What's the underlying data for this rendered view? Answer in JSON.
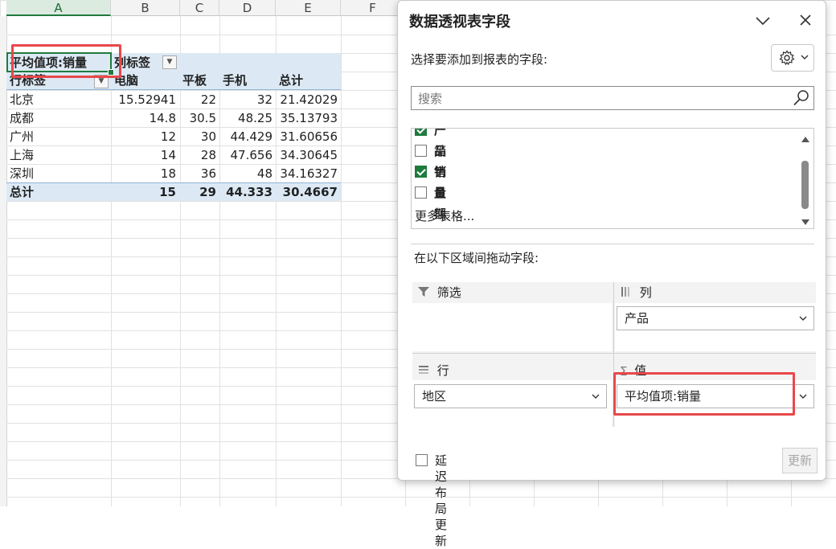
{
  "sheet": {
    "columns": [
      "A",
      "B",
      "C",
      "D",
      "E",
      "F"
    ],
    "pivot": {
      "value_label": "平均值项:销量",
      "col_label": "列标签",
      "row_label": "行标签",
      "headers": [
        "电脑",
        "平板",
        "手机",
        "总计"
      ],
      "rows": [
        {
          "name": "北京",
          "v": [
            "15.52941",
            "22",
            "32",
            "21.42029"
          ]
        },
        {
          "name": "成都",
          "v": [
            "14.8",
            "30.5",
            "48.25",
            "35.13793"
          ]
        },
        {
          "name": "广州",
          "v": [
            "12",
            "30",
            "44.429",
            "31.60656"
          ]
        },
        {
          "name": "上海",
          "v": [
            "14",
            "28",
            "47.656",
            "34.30645"
          ]
        },
        {
          "name": "深圳",
          "v": [
            "18",
            "36",
            "48",
            "34.16327"
          ]
        }
      ],
      "total": {
        "name": "总计",
        "v": [
          "15",
          "29",
          "44.333",
          "30.4667"
        ]
      }
    }
  },
  "pane": {
    "title": "数据透视表字段",
    "subtitle": "选择要添加到报表的字段:",
    "search_placeholder": "搜索",
    "fields": [
      {
        "label": "产品",
        "checked": true
      },
      {
        "label": "销售日期",
        "checked": false
      },
      {
        "label": "销量",
        "checked": true
      },
      {
        "label": "金额",
        "checked": false
      }
    ],
    "more_tables": "更多表格...",
    "drag_label": "在以下区域间拖动字段:",
    "zones": {
      "filter": "筛选",
      "columns": "列",
      "rows": "行",
      "values": "值"
    },
    "columns_value": "产品",
    "rows_value": "地区",
    "values_value": "平均值项:销量",
    "defer_label": "延迟布局更新",
    "update_label": "更新",
    "icons": [
      "chevron-down-icon",
      "close-icon",
      "gear-icon",
      "search-icon",
      "filter-icon",
      "columns-icon",
      "rows-icon",
      "sigma-icon"
    ]
  },
  "colors": {
    "accent": "#1f7a3e",
    "pivot_band": "#dce9f5",
    "highlight": "#e8484a"
  }
}
